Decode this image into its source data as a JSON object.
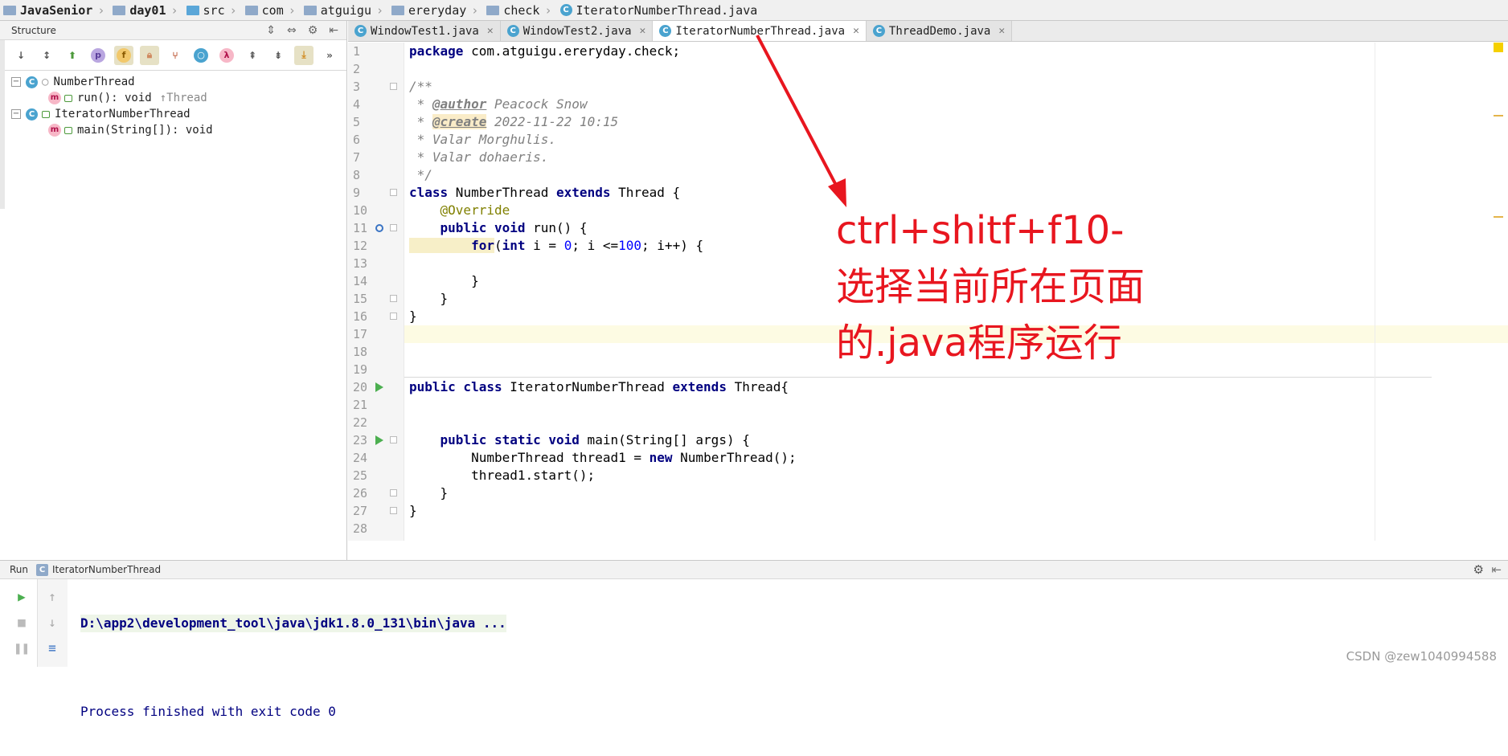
{
  "breadcrumb": [
    "JavaSenior",
    "day01",
    "src",
    "com",
    "atguigu",
    "ereryday",
    "check",
    "IteratorNumberThread.java"
  ],
  "structure": {
    "title": "Structure",
    "toolbar_icons": [
      "sort-by-visibility-icon",
      "sort-alphabetically-icon",
      "show-inherited-icon",
      "show-properties-icon",
      "show-fields-icon",
      "show-non-public-icon",
      "show-anonymous-icon",
      "show-lambdas-icon",
      "expand-all-icon",
      "collapse-all-icon",
      "autoscroll-icon"
    ],
    "tree": [
      {
        "label": "NumberThread",
        "kind": "class",
        "children": [
          {
            "label": "run(): void",
            "inherit": "↑Thread"
          }
        ]
      },
      {
        "label": "IteratorNumberThread",
        "kind": "class",
        "children": [
          {
            "label": "main(String[]): void",
            "inherit": ""
          }
        ]
      }
    ]
  },
  "tabs": [
    "WindowTest1.java",
    "WindowTest2.java",
    "IteratorNumberThread.java",
    "ThreadDemo.java"
  ],
  "active_tab": "IteratorNumberThread.java",
  "editor": {
    "lines": [
      "1",
      "2",
      "3",
      "4",
      "5",
      "6",
      "7",
      "8",
      "9",
      "10",
      "11",
      "12",
      "13",
      "14",
      "15",
      "16",
      "17",
      "18",
      "19",
      "20",
      "21",
      "22",
      "23",
      "24",
      "25",
      "26",
      "27",
      "28"
    ],
    "code": {
      "l1a": "package",
      "l1b": " com.atguigu.ereryday.check;",
      "l3": "/**",
      "l4a": " * ",
      "l4b": "@author",
      "l4c": " Peacock Snow",
      "l5a": " * ",
      "l5b": "@create",
      "l5c": " 2022-11-22 10:15",
      "l6": " * Valar Morghulis.",
      "l7": " * Valar dohaeris.",
      "l8": " */",
      "l9a": "class",
      "l9b": " NumberThread ",
      "l9c": "extends",
      "l9d": " Thread {",
      "l10": "    @Override",
      "l11a": "    public void",
      "l11b": " run() {",
      "l12a": "        for",
      "l12b": "(",
      "l12c": "int",
      "l12d": " i = ",
      "l12e": "0",
      "l12f": "; i <=",
      "l12g": "100",
      "l12h": "; i++) {",
      "l14": "        }",
      "l15": "    }",
      "l16": "}",
      "l20a": "public class",
      "l20b": " IteratorNumberThread ",
      "l20c": "extends",
      "l20d": " Thread{",
      "l23a": "    public static void",
      "l23b": " main(String[] args) {",
      "l24a": "        NumberThread thread1 = ",
      "l24b": "new",
      "l24c": " NumberThread();",
      "l25": "        thread1.start();",
      "l26": "    }",
      "l27": "}"
    }
  },
  "annotation": [
    "ctrl+shitf+f10-",
    "选择当前所在页面",
    "的.java程序运行"
  ],
  "run": {
    "label": "Run",
    "config": "IteratorNumberThread",
    "console": [
      "D:\\app2\\development_tool\\java\\jdk1.8.0_131\\bin\\java ...",
      "",
      "Process finished with exit code 0"
    ]
  },
  "watermark": "CSDN @zew1040994588",
  "colors": {
    "annotation": "#e8161f",
    "keyword": "#000080",
    "comment": "#808080",
    "number": "#0000ff",
    "annotation_code": "#808000"
  }
}
